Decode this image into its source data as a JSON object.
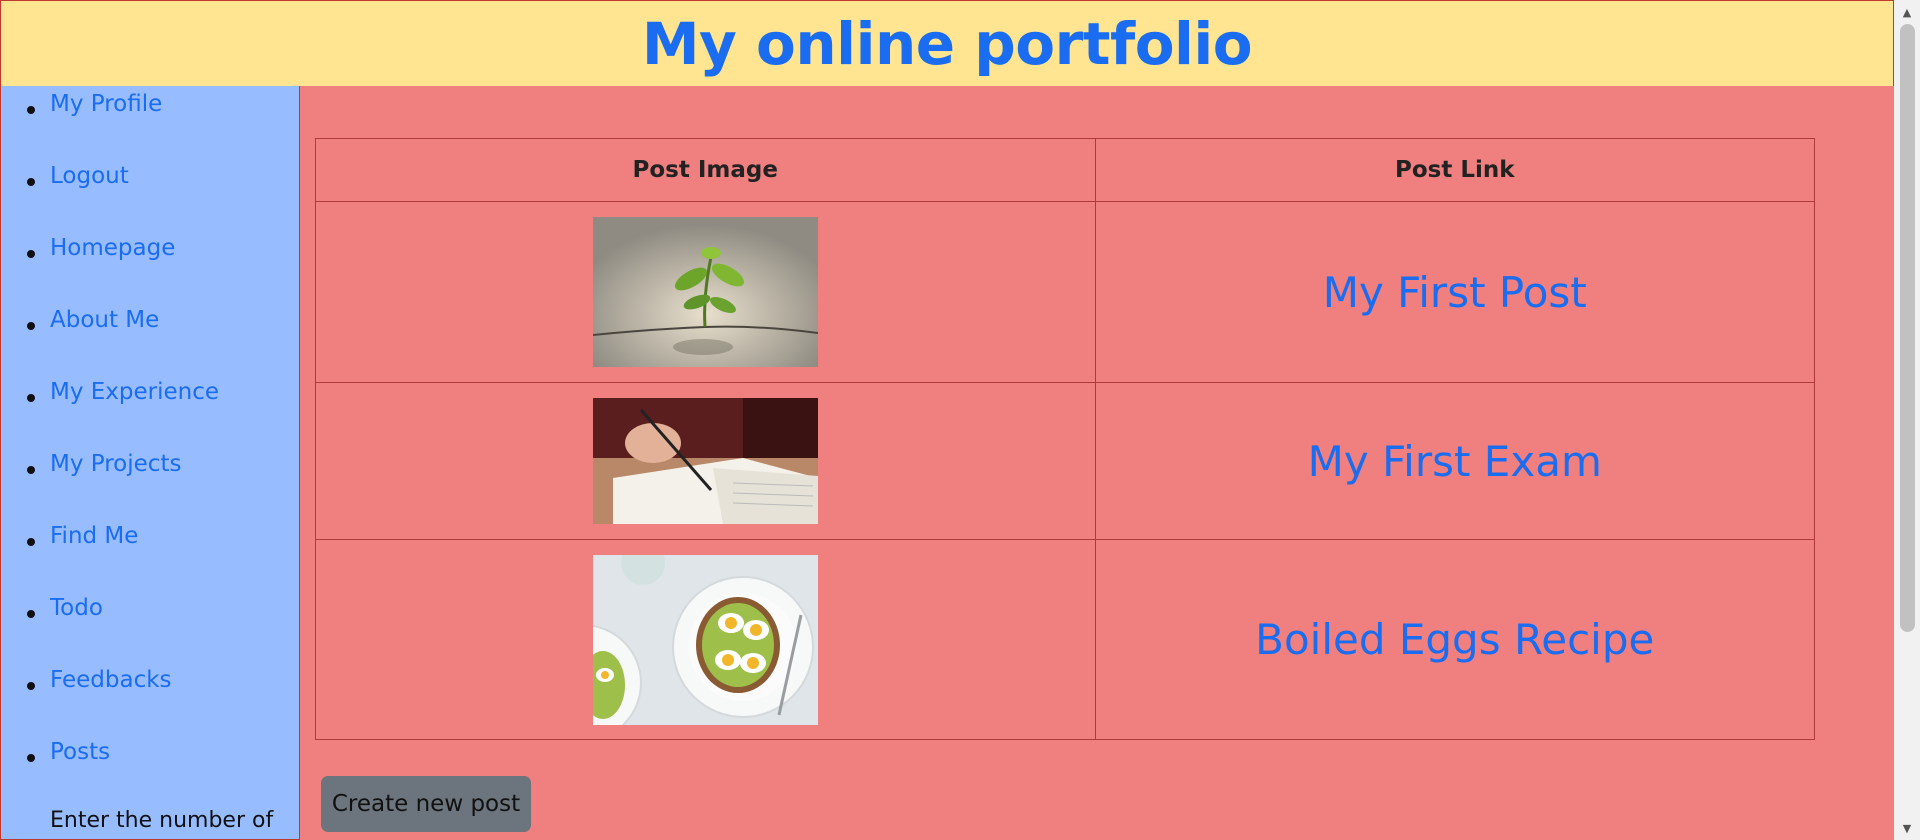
{
  "header": {
    "title": "My online portfolio"
  },
  "sidebar": {
    "items": [
      {
        "label": "My Profile"
      },
      {
        "label": "Logout"
      },
      {
        "label": "Homepage"
      },
      {
        "label": "About Me"
      },
      {
        "label": "My Experience"
      },
      {
        "label": "My Projects"
      },
      {
        "label": "Find Me"
      },
      {
        "label": "Todo"
      },
      {
        "label": "Feedbacks"
      },
      {
        "label": "Posts"
      }
    ],
    "note": "Enter the number of"
  },
  "table": {
    "headers": [
      "Post Image",
      "Post Link"
    ],
    "rows": [
      {
        "image": "sprout-photo",
        "link": "My First Post"
      },
      {
        "image": "writing-exam-photo",
        "link": "My First Exam"
      },
      {
        "image": "eggs-toast-photo",
        "link": "Boiled Eggs Recipe"
      }
    ]
  },
  "actions": {
    "create_label": "Create new post"
  },
  "colors": {
    "header_bg": "#ffe591",
    "sidebar_bg": "#97bcff",
    "main_bg": "#f08080",
    "link": "#1a6cf0",
    "button_bg": "#6c757d"
  }
}
